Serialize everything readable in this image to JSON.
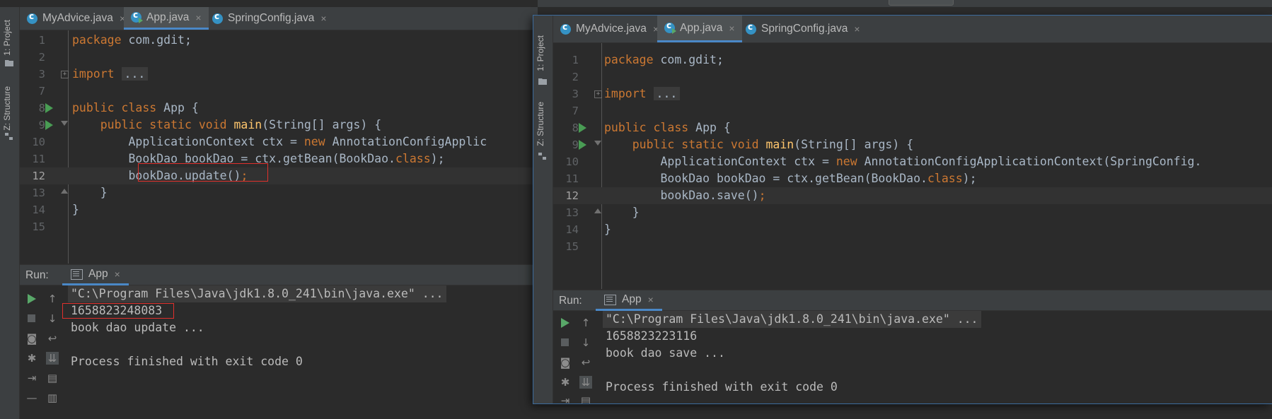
{
  "left_window": {
    "sidebar": {
      "project_label": "1: Project",
      "structure_label": "Z: Structure"
    },
    "tabs": [
      {
        "label": "MyAdvice.java",
        "close": "×",
        "active": false
      },
      {
        "label": "App.java",
        "close": "×",
        "active": true
      },
      {
        "label": "SpringConfig.java",
        "close": "×",
        "active": false
      }
    ],
    "lines": [
      {
        "num": "1"
      },
      {
        "num": "2"
      },
      {
        "num": "3"
      },
      {
        "num": "7"
      },
      {
        "num": "8"
      },
      {
        "num": "9"
      },
      {
        "num": "10"
      },
      {
        "num": "11"
      },
      {
        "num": "12"
      },
      {
        "num": "13"
      },
      {
        "num": "14"
      },
      {
        "num": "15"
      }
    ],
    "code": {
      "l1_kw": "package",
      "l1_rest": " com.gdit;",
      "l3_kw": "import",
      "l3_fold": "...",
      "l8_kw": "public class",
      "l8_rest": " App {",
      "l9_kw": "public static void",
      "l9_fn": "main",
      "l9_rest": "(String[] args) {",
      "l10_a": "ApplicationContext ctx = ",
      "l10_kw": "new",
      "l10_b": " AnnotationConfigApplic",
      "l11_a": "BookDao bookDao = ctx.getBean(BookDao.",
      "l11_kw": "class",
      "l11_b": ");",
      "l12_a": "bookDao.update()",
      "l12_b": ";",
      "l13": "}",
      "l14": "}"
    },
    "run": {
      "label": "Run:",
      "tab": "App",
      "close": "×",
      "output": [
        "\"C:\\Program Files\\Java\\jdk1.8.0_241\\bin\\java.exe\" ...",
        "1658823248083",
        "book dao update ...",
        "",
        "Process finished with exit code 0"
      ]
    }
  },
  "right_window": {
    "sidebar": {
      "project_label": "1: Project",
      "structure_label": "Z: Structure"
    },
    "tabs": [
      {
        "label": "MyAdvice.java",
        "close": "×",
        "active": false
      },
      {
        "label": "App.java",
        "close": "×",
        "active": true
      },
      {
        "label": "SpringConfig.java",
        "close": "×",
        "active": false
      }
    ],
    "lines": [
      {
        "num": "1"
      },
      {
        "num": "2"
      },
      {
        "num": "3"
      },
      {
        "num": "7"
      },
      {
        "num": "8"
      },
      {
        "num": "9"
      },
      {
        "num": "10"
      },
      {
        "num": "11"
      },
      {
        "num": "12"
      },
      {
        "num": "13"
      },
      {
        "num": "14"
      },
      {
        "num": "15"
      }
    ],
    "code": {
      "l1_kw": "package",
      "l1_rest": " com.gdit;",
      "l3_kw": "import",
      "l3_fold": "...",
      "l8_kw": "public class",
      "l8_rest": " App {",
      "l9_kw": "public static void",
      "l9_fn": "main",
      "l9_rest": "(String[] args) {",
      "l10_a": "ApplicationContext ctx = ",
      "l10_kw": "new",
      "l10_b": " AnnotationConfigApplicationContext(SpringConfig.",
      "l11_a": "BookDao bookDao = ctx.getBean(BookDao.",
      "l11_kw": "class",
      "l11_b": ");",
      "l12_a": "bookDao.save()",
      "l12_b": ";",
      "l13": "}",
      "l14": "}"
    },
    "run": {
      "label": "Run:",
      "tab": "App",
      "close": "×",
      "output": [
        "\"C:\\Program Files\\Java\\jdk1.8.0_241\\bin\\java.exe\" ...",
        "1658823223116",
        "book dao save ...",
        "",
        "Process finished with exit code 0"
      ]
    }
  },
  "colors": {
    "keyword": "#cc7832",
    "method": "#ffc66d",
    "text": "#a9b7c6",
    "highlight_box": "#e0302c",
    "accent": "#4a88c7"
  }
}
